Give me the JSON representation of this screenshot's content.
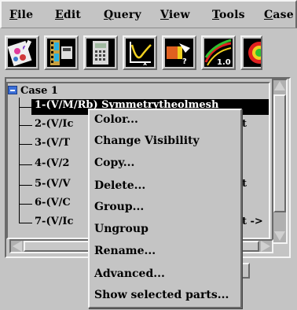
{
  "menubar": {
    "items": [
      {
        "mnemonic": "F",
        "rest": "ile"
      },
      {
        "mnemonic": "E",
        "rest": "dit"
      },
      {
        "mnemonic": "Q",
        "rest": "uery"
      },
      {
        "mnemonic": "V",
        "rest": "iew"
      },
      {
        "mnemonic": "T",
        "rest": "ools"
      },
      {
        "mnemonic": "C",
        "rest": "ase"
      }
    ]
  },
  "toolbar": {
    "tools": [
      {
        "icon": "part-colors-icon"
      },
      {
        "icon": "film-strip-icon"
      },
      {
        "icon": "calculator-icon"
      },
      {
        "icon": "xy-plot-icon"
      },
      {
        "icon": "query-probe-icon"
      },
      {
        "icon": "contour-legend-icon"
      },
      {
        "icon": "sphere-icon"
      }
    ],
    "contour_value": "1.0"
  },
  "tree": {
    "root": "Case 1",
    "parts": [
      "1-(V/M/R",
      "2-(V/Ic",
      "3-(V/T",
      "4-(V/2",
      "5-(V/V",
      "6-(V/C",
      "7-(V/Ic"
    ],
    "part1_visible_tail": "b) Symmetrytheolmesh",
    "part2_visible_tail": "t",
    "part5_visible_tail": "t",
    "part7_visible_tail": "t ->"
  },
  "context_menu": {
    "items": [
      "Color...",
      "Change Visibility",
      "Copy...",
      "Delete...",
      "Group...",
      "Ungroup",
      "Rename...",
      "Advanced...",
      "Show selected parts..."
    ]
  },
  "colors": {
    "background": "#c4c4c4",
    "selection": "#000000",
    "root_icon": "#3b6fd8"
  }
}
